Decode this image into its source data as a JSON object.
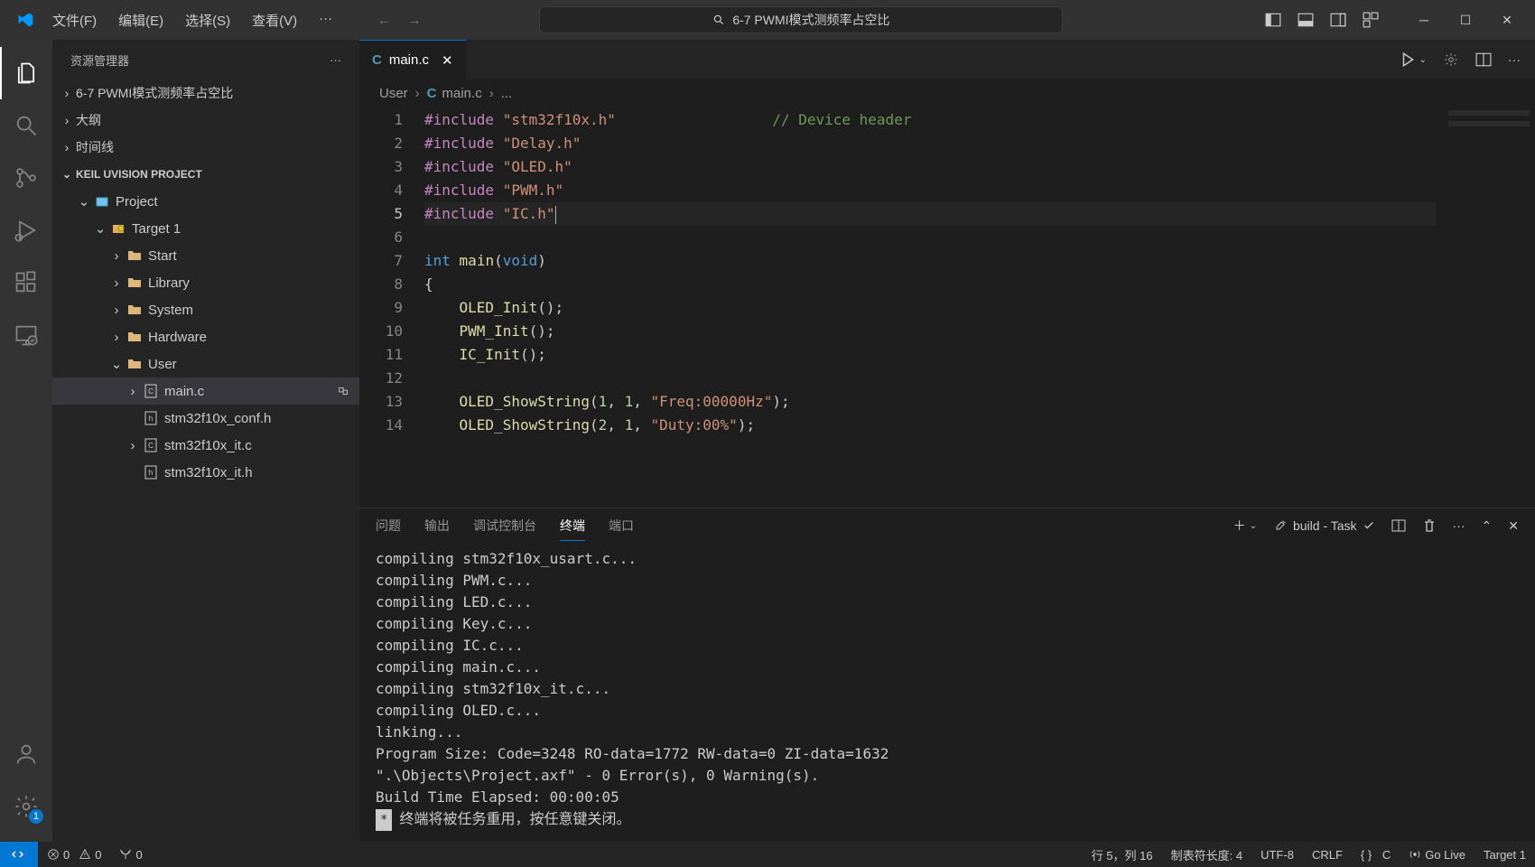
{
  "titlebar": {
    "menu": [
      "文件(F)",
      "编辑(E)",
      "选择(S)",
      "查看(V)",
      "···"
    ],
    "search_text": "6-7 PWMI模式测频率占空比"
  },
  "sidebar": {
    "title": "资源管理器",
    "sections": [
      {
        "label": "6-7 PWMI模式测频率占空比",
        "expanded": false
      },
      {
        "label": "大纲",
        "expanded": false
      },
      {
        "label": "时间线",
        "expanded": false
      },
      {
        "label": "KEIL UVISION PROJECT",
        "expanded": true
      }
    ],
    "tree": [
      {
        "indent": 1,
        "chev": "v",
        "icon": "project",
        "label": "Project"
      },
      {
        "indent": 2,
        "chev": "v",
        "icon": "target",
        "label": "Target 1"
      },
      {
        "indent": 3,
        "chev": ">",
        "icon": "folder",
        "label": "Start"
      },
      {
        "indent": 3,
        "chev": ">",
        "icon": "folder",
        "label": "Library"
      },
      {
        "indent": 3,
        "chev": ">",
        "icon": "folder",
        "label": "System"
      },
      {
        "indent": 3,
        "chev": ">",
        "icon": "folder",
        "label": "Hardware"
      },
      {
        "indent": 3,
        "chev": "v",
        "icon": "folder",
        "label": "User"
      },
      {
        "indent": 4,
        "chev": ">",
        "icon": "c-file",
        "label": "main.c",
        "selected": true,
        "badge": true
      },
      {
        "indent": 4,
        "chev": "",
        "icon": "h-file",
        "label": "stm32f10x_conf.h"
      },
      {
        "indent": 4,
        "chev": ">",
        "icon": "c-file",
        "label": "stm32f10x_it.c"
      },
      {
        "indent": 4,
        "chev": "",
        "icon": "h-file",
        "label": "stm32f10x_it.h"
      }
    ]
  },
  "tab": {
    "icon": "C",
    "label": "main.c"
  },
  "breadcrumbs": [
    "User",
    "main.c",
    "..."
  ],
  "code_lines": [
    {
      "n": 1,
      "html": "<span class='kw'>#include</span> <span class='str'>\"stm32f10x.h\"</span>                  <span class='comment'>// Device header</span>"
    },
    {
      "n": 2,
      "html": "<span class='kw'>#include</span> <span class='str'>\"Delay.h\"</span>"
    },
    {
      "n": 3,
      "html": "<span class='kw'>#include</span> <span class='str'>\"OLED.h\"</span>"
    },
    {
      "n": 4,
      "html": "<span class='kw'>#include</span> <span class='str'>\"PWM.h\"</span>"
    },
    {
      "n": 5,
      "html": "<span class='kw'>#include</span> <span class='str'>\"IC.h\"</span><span class='cursor'></span>",
      "active": true
    },
    {
      "n": 6,
      "html": ""
    },
    {
      "n": 7,
      "html": "<span class='type'>int</span> <span class='fn'>main</span>(<span class='type'>void</span>)"
    },
    {
      "n": 8,
      "html": "{"
    },
    {
      "n": 9,
      "html": "    <span class='fn'>OLED_Init</span>();"
    },
    {
      "n": 10,
      "html": "    <span class='fn'>PWM_Init</span>();"
    },
    {
      "n": 11,
      "html": "    <span class='fn'>IC_Init</span>();"
    },
    {
      "n": 12,
      "html": ""
    },
    {
      "n": 13,
      "html": "    <span class='fn'>OLED_ShowString</span>(<span class='num'>1</span>, <span class='num'>1</span>, <span class='str'>\"Freq:00000Hz\"</span>);"
    },
    {
      "n": 14,
      "html": "    <span class='fn'>OLED_ShowString</span>(<span class='num'>2</span>, <span class='num'>1</span>, <span class='str'>\"Duty:00%\"</span>);"
    }
  ],
  "panel": {
    "tabs": [
      "问题",
      "输出",
      "调试控制台",
      "终端",
      "端口"
    ],
    "active_tab": 3,
    "task_label": "build - Task",
    "terminal_lines": [
      "compiling stm32f10x_usart.c...",
      "compiling PWM.c...",
      "compiling LED.c...",
      "compiling Key.c...",
      "compiling IC.c...",
      "compiling main.c...",
      "compiling stm32f10x_it.c...",
      "compiling OLED.c...",
      "linking...",
      "Program Size: Code=3248 RO-data=1772 RW-data=0 ZI-data=1632",
      "\".\\Objects\\Project.axf\" - 0 Error(s), 0 Warning(s).",
      "Build Time Elapsed:  00:00:05"
    ],
    "terminal_footer": "终端将被任务重用，按任意键关闭。",
    "terminal_badge": "*"
  },
  "statusbar": {
    "errors": "0",
    "warnings": "0",
    "ports": "0",
    "cursor": "行 5，列 16",
    "tabsize": "制表符长度: 4",
    "encoding": "UTF-8",
    "eol": "CRLF",
    "lang_braces": "{ }",
    "lang": "C",
    "golive": "Go Live",
    "target": "Target 1"
  },
  "settings_badge": "1"
}
